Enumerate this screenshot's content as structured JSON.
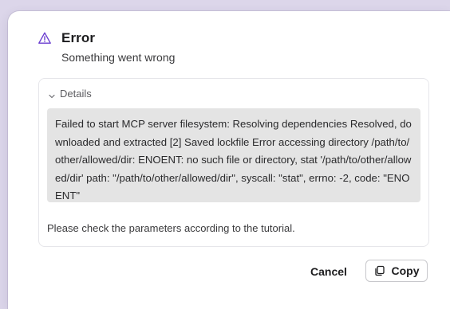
{
  "dialog": {
    "title": "Error",
    "subtitle": "Something went wrong",
    "icon": "warning-triangle-icon"
  },
  "details": {
    "label": "Details",
    "expanded": true,
    "chevron_icon": "chevron-down-icon",
    "error_text": "Failed to start MCP server filesystem: Resolving dependencies Resolved, downloaded and extracted [2] Saved lockfile Error accessing directory /path/to/other/allowed/dir: ENOENT: no such file or directory, stat '/path/to/other/allowed/dir' path: \"/path/to/other/allowed/dir\", syscall: \"stat\", errno: -2, code: \"ENOENT\"",
    "help_text": "Please check the parameters according to the tutorial."
  },
  "actions": {
    "cancel_label": "Cancel",
    "copy_label": "Copy",
    "copy_icon": "copy-icon"
  },
  "colors": {
    "background": "#dcd6ea",
    "dialog": "#ffffff",
    "error_box": "#e4e4e4",
    "text_primary": "#1c1c1e"
  }
}
